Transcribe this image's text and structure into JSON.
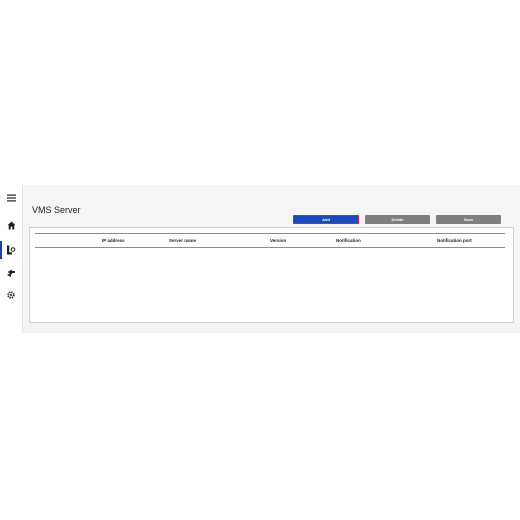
{
  "page": {
    "title": "VMS Server"
  },
  "sidebar": {
    "items": [
      {
        "icon": "menu-icon"
      },
      {
        "icon": "home-icon"
      },
      {
        "icon": "server-settings-icon",
        "active": true
      },
      {
        "icon": "transfer-icon"
      },
      {
        "icon": "gear-icon"
      }
    ]
  },
  "toolbar": {
    "add_label": "Add",
    "delete_label": "Delete",
    "save_label": "Save"
  },
  "table": {
    "columns": [
      "IP address",
      "Server name",
      "Version",
      "Notification",
      "Notification port"
    ],
    "rows": []
  },
  "colors": {
    "accent": "#1c49b8",
    "focus_border": "#d71e2a",
    "disabled_button": "#7f7f7f"
  }
}
